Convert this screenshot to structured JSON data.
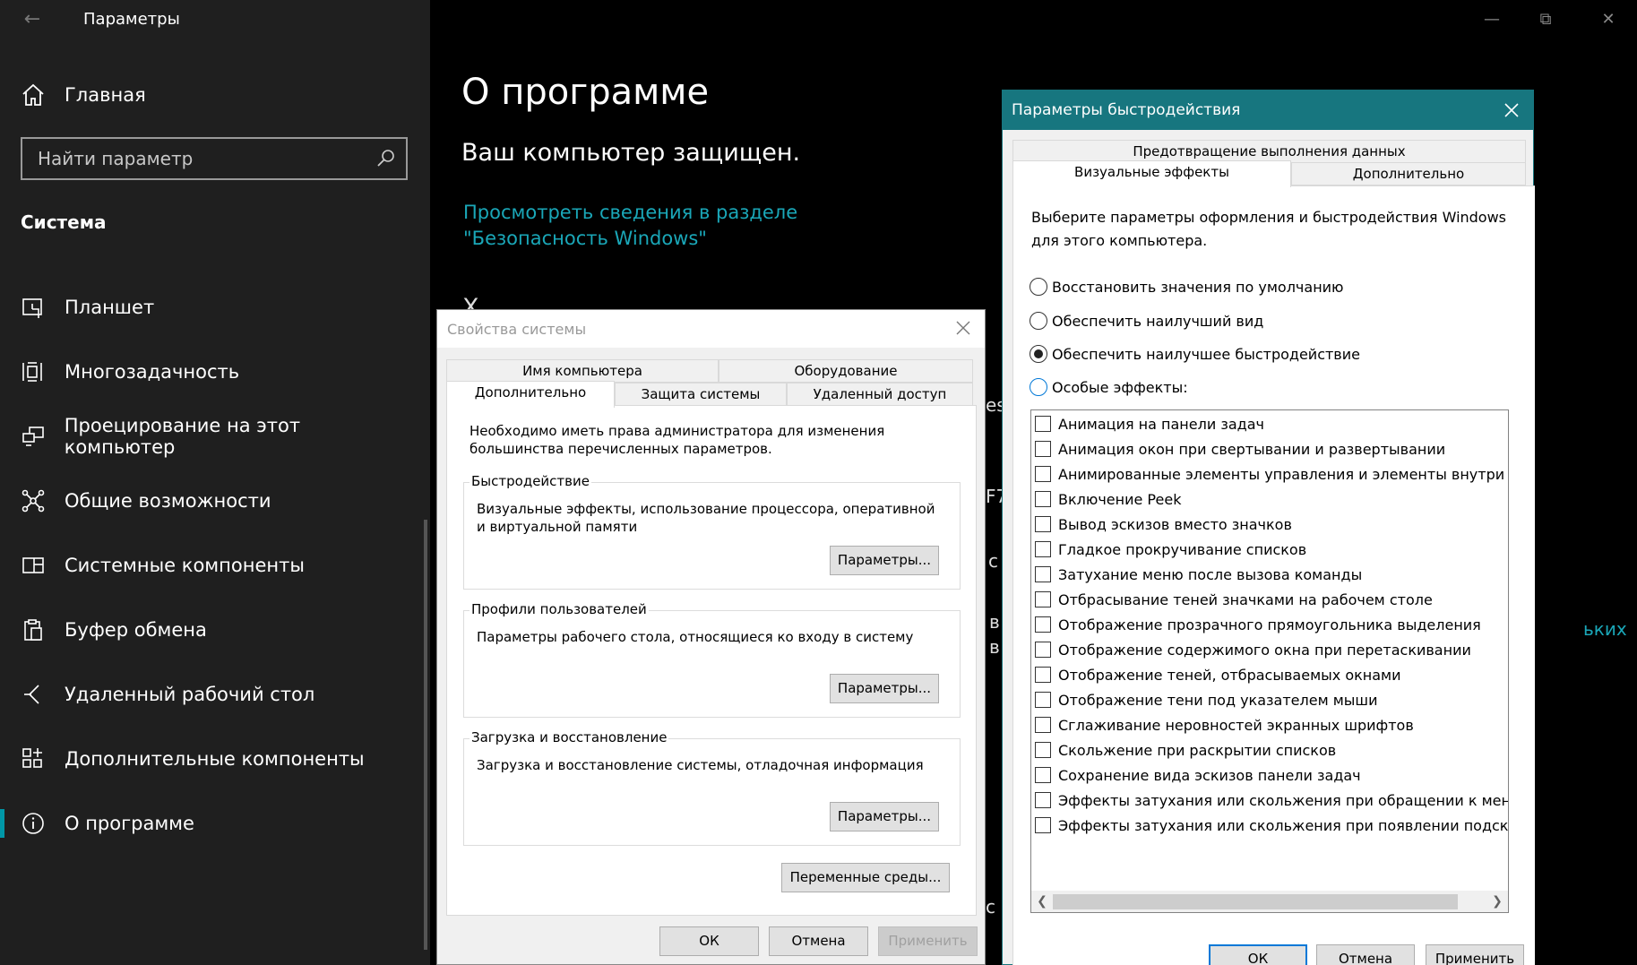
{
  "app": {
    "title": "Параметры",
    "back_icon": "back-arrow-icon",
    "window_controls": [
      "minimize",
      "restore",
      "close"
    ]
  },
  "sidebar": {
    "home_label": "Главная",
    "search_placeholder": "Найти параметр",
    "section_title": "Система",
    "items": [
      {
        "label": "Планшет",
        "icon": "tablet-icon"
      },
      {
        "label": "Многозадачность",
        "icon": "multitasking-icon"
      },
      {
        "label": "Проецирование на этот компьютер",
        "icon": "projecting-icon"
      },
      {
        "label": "Общие возможности",
        "icon": "shared-experiences-icon"
      },
      {
        "label": "Системные компоненты",
        "icon": "system-components-icon"
      },
      {
        "label": "Буфер обмена",
        "icon": "clipboard-icon"
      },
      {
        "label": "Удаленный рабочий стол",
        "icon": "remote-desktop-icon"
      },
      {
        "label": "Дополнительные компоненты",
        "icon": "optional-features-icon"
      },
      {
        "label": "О программе",
        "icon": "info-icon",
        "active": true
      }
    ]
  },
  "main": {
    "title": "О программе",
    "protected_text": "Ваш компьютер защищен.",
    "security_link": "Просмотреть сведения в разделе \"Безопасность Windows\"",
    "hidden_fragments": {
      "heading_start": "Х",
      "right_1": "ess",
      "right_2": "F7",
      "right_3": "с",
      "right_4": "в",
      "right_5": "в",
      "right_6": "с",
      "teal_frag": "ьких"
    }
  },
  "system_properties": {
    "title": "Свойства системы",
    "tabs_row1": [
      "Имя компьютера",
      "Оборудование"
    ],
    "tabs_row2": [
      "Дополнительно",
      "Защита системы",
      "Удаленный доступ"
    ],
    "selected_tab": "Дополнительно",
    "admin_note": "Необходимо иметь права администратора для изменения большинства перечисленных параметров.",
    "groups": [
      {
        "title": "Быстродействие",
        "text": "Визуальные эффекты, использование процессора, оперативной и виртуальной памяти",
        "button": "Параметры..."
      },
      {
        "title": "Профили пользователей",
        "text": "Параметры рабочего стола, относящиеся ко входу в систему",
        "button": "Параметры..."
      },
      {
        "title": "Загрузка и восстановление",
        "text": "Загрузка и восстановление системы, отладочная информация",
        "button": "Параметры..."
      }
    ],
    "env_button": "Переменные среды...",
    "ok": "ОК",
    "cancel": "Отмена",
    "apply": "Применить"
  },
  "performance_options": {
    "title": "Параметры быстродействия",
    "tabs_row1": [
      "Предотвращение выполнения данных"
    ],
    "tabs_row2": [
      "Визуальные эффекты",
      "Дополнительно"
    ],
    "selected_tab": "Визуальные эффекты",
    "description": "Выберите параметры оформления и быстродействия Windows для этого компьютера.",
    "radios": [
      {
        "label": "Восстановить значения по умолчанию",
        "checked": false
      },
      {
        "label": "Обеспечить наилучший вид",
        "checked": false
      },
      {
        "label": "Обеспечить наилучшее быстродействие",
        "checked": true
      },
      {
        "label": "Особые эффекты:",
        "checked": false
      }
    ],
    "effects": [
      {
        "label": "Анимация на панели задач",
        "checked": false
      },
      {
        "label": "Анимация окон при свертывании и развертывании",
        "checked": false
      },
      {
        "label": "Анимированные элементы управления и элементы внутри ок",
        "checked": false
      },
      {
        "label": "Включение Peek",
        "checked": false
      },
      {
        "label": "Вывод эскизов вместо значков",
        "checked": false
      },
      {
        "label": "Гладкое прокручивание списков",
        "checked": false
      },
      {
        "label": "Затухание меню после вызова команды",
        "checked": false
      },
      {
        "label": "Отбрасывание теней значками на рабочем столе",
        "checked": false
      },
      {
        "label": "Отображение прозрачного прямоугольника выделения",
        "checked": false
      },
      {
        "label": "Отображение содержимого окна при перетаскивании",
        "checked": false
      },
      {
        "label": "Отображение теней, отбрасываемых окнами",
        "checked": false
      },
      {
        "label": "Отображение тени под указателем мыши",
        "checked": false
      },
      {
        "label": "Сглаживание неровностей экранных шрифтов",
        "checked": false
      },
      {
        "label": "Скольжение при раскрытии списков",
        "checked": false
      },
      {
        "label": "Сохранение вида эскизов панели задач",
        "checked": false
      },
      {
        "label": "Эффекты затухания или скольжения при обращении к меню",
        "checked": false
      },
      {
        "label": "Эффекты затухания или скольжения при появлении подсказо",
        "checked": false
      }
    ],
    "ok": "ОК",
    "cancel": "Отмена",
    "apply": "Применить"
  },
  "colors": {
    "accent": "#0097a7",
    "link": "#1aa7b8",
    "perf_title_bar": "#17767f"
  }
}
